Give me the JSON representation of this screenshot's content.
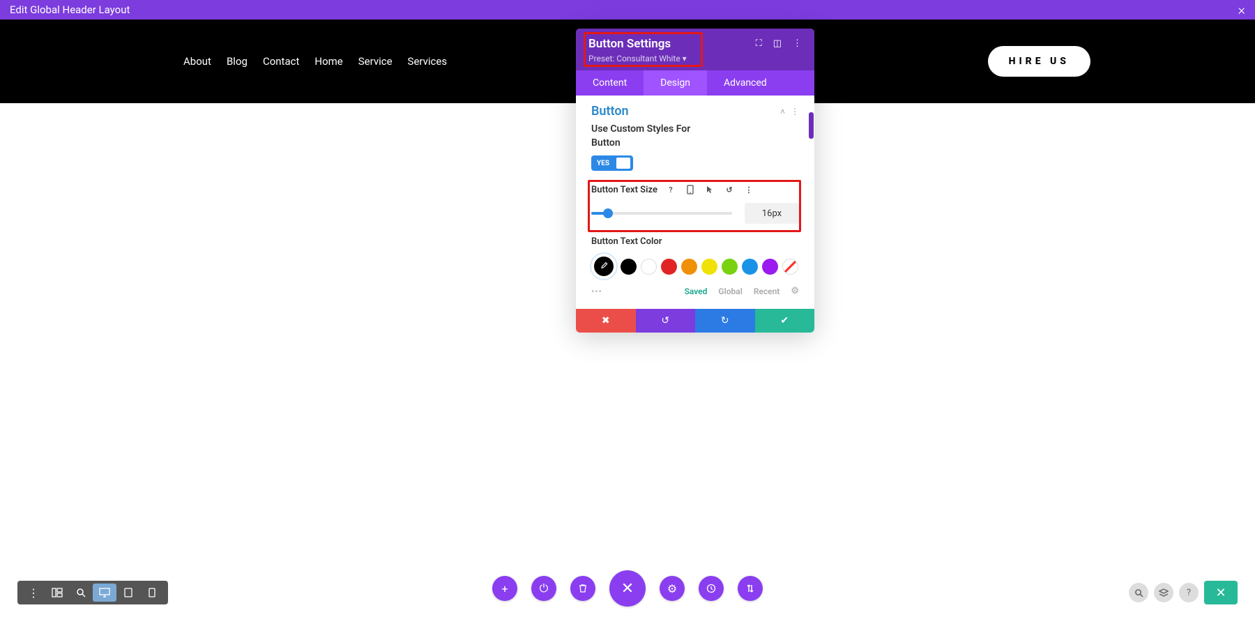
{
  "topbar": {
    "title": "Edit Global Header Layout"
  },
  "nav": {
    "items": [
      "About",
      "Blog",
      "Contact",
      "Home",
      "Service",
      "Services"
    ],
    "hire": "HIRE US"
  },
  "panel": {
    "title": "Button Settings",
    "preset": "Preset: Consultant White ▾",
    "tabs": [
      "Content",
      "Design",
      "Advanced"
    ],
    "activeTab": 1,
    "section": {
      "title": "Button"
    },
    "customStylesLabel": "Use Custom Styles For Button",
    "toggle": {
      "value": "YES"
    },
    "textSize": {
      "label": "Button Text Size",
      "value": "16px"
    },
    "textColor": {
      "label": "Button Text Color"
    },
    "swatches": [
      "#000000",
      "#ffffff",
      "#e02424",
      "#f09009",
      "#f0e209",
      "#78d20f",
      "#1a93e6",
      "#9a1af0"
    ],
    "paletteTabs": {
      "saved": "Saved",
      "global": "Global",
      "recent": "Recent"
    }
  },
  "bottomCenter": {
    "icons": [
      "plus",
      "power",
      "trash",
      "close",
      "gear",
      "clock",
      "sliders"
    ]
  }
}
